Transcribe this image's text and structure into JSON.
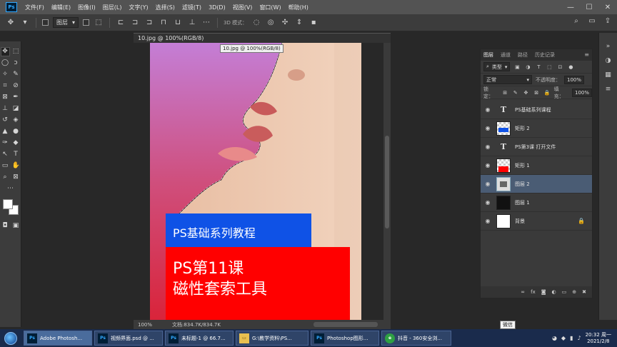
{
  "app": {
    "logo_text": "Ps",
    "menu": [
      "文件(F)",
      "编辑(E)",
      "图像(I)",
      "图层(L)",
      "文字(Y)",
      "选择(S)",
      "滤镜(T)",
      "3D(D)",
      "视图(V)",
      "窗口(W)",
      "帮助(H)"
    ],
    "window_controls": {
      "minimize": "—",
      "maximize": "☐",
      "close": "✕"
    }
  },
  "options": {
    "layer_select": "图层",
    "mode_3d": "3D 模式："
  },
  "document": {
    "tab_title": "10.jpg @ 100%(RGB/8)",
    "tooltip": "10.jpg @ 100%(RGB/8)",
    "zoom": "100%",
    "doc_info": "文档:834.7K/834.7K",
    "banner_blue": "PS基础系列教程",
    "banner_red_line1": "PS第11课",
    "banner_red_line2": "磁性套索工具"
  },
  "layers_panel": {
    "tabs": [
      "图层",
      "通道",
      "路径",
      "历史记录"
    ],
    "filter": "类型",
    "blend_mode": "正常",
    "opacity_label": "不透明度：",
    "opacity_value": "100%",
    "lock_label": "锁定：",
    "fill_label": "填充：",
    "fill_value": "100%",
    "layers": [
      {
        "name": "PS基础系列课程",
        "type": "text"
      },
      {
        "name": "矩形 2",
        "type": "shape-blue"
      },
      {
        "name": "PS第3课 打开文件",
        "type": "text"
      },
      {
        "name": "矩形 1",
        "type": "shape-red"
      },
      {
        "name": "图层 2",
        "type": "pixel-selected"
      },
      {
        "name": "图层 1",
        "type": "pixel-dark"
      },
      {
        "name": "背景",
        "type": "background"
      }
    ],
    "footer_icons": [
      "link-icon",
      "fx-icon",
      "mask-icon",
      "adjust-icon",
      "folder-icon",
      "new-layer-icon",
      "trash-icon"
    ]
  },
  "taskbar": {
    "items": [
      {
        "label": "Adobe Photosh...",
        "icon": "Ps"
      },
      {
        "label": "视频界面.psd @ ...",
        "icon": "Ps"
      },
      {
        "label": "未标题-1 @ 66.7...",
        "icon": "Ps"
      },
      {
        "label": "G:\\教学资料\\PS...",
        "icon": "folder"
      },
      {
        "label": "Photoshop图形...",
        "icon": "Ps"
      },
      {
        "label": "抖音 - 360安全浏...",
        "icon": "360"
      }
    ],
    "tooltip": "微信",
    "time": "20:32 周一",
    "date": "2021/2/8"
  }
}
